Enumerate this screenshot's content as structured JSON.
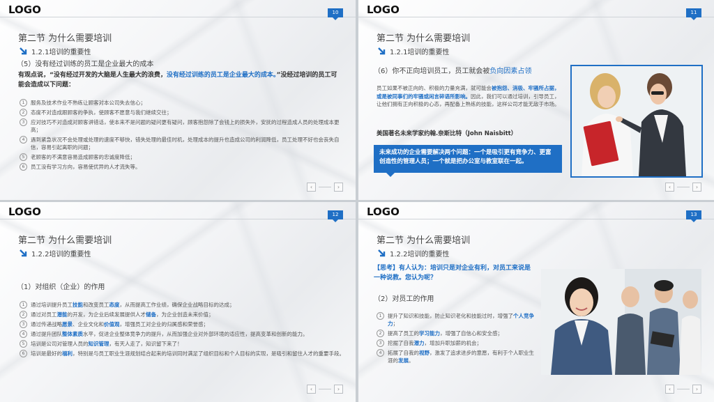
{
  "common": {
    "logo": "LOGO",
    "section_title": "第二节  为什么需要培训",
    "nav_prev": "‹",
    "nav_next": "›"
  },
  "slide1": {
    "page": "10",
    "subtitle": "1.2.1培训的重要性",
    "point": "（5）没有经过训练的员工是企业最大的成本",
    "intro_a": "有观点说，“没有经过开发的大脑是人生最大的浪费，",
    "intro_b": "没有经过训练的员工是企业最大的成本。",
    "intro_c": "”没经过培训的员工可能会造成以下问题：",
    "items": [
      "服务及技术作业不熟练让顾客对本公司失去信心；",
      "态度不对造成跟顾客的争执，使顾客不愿意与我们继续交往；",
      "应对技巧不对造成对顾客讲错话，使本来不是问题的疑问更有疑问，顾客抱怨除了会钱上的损失外，安抚的过程造成人员的处理成本更高；",
      "遇到紧急状况不会处理或处理的速度不够快，错失处理的最佳时机，处理成本的提升也造成公司的利润降低，员工处理不好也会丧失自信，容易引起离职的问题；",
      "老顾客的不满意容易造成顾客的忠诚度降低；",
      "员工没有学习方向，容易使优异的人才流失等。"
    ]
  },
  "slide2": {
    "page": "11",
    "subtitle": "1.2.1培训的重要性",
    "point_a": "（6）你不正向培训员工，员工就会被",
    "point_b": "负向因素占领",
    "body_a": "员工如果不被正向的、积极的力量充满，就可能会",
    "body_b": "被抱怨、消极、牢骚所占据，或是被同事们的牢骚或闲言碎语所影响。",
    "body_c": "因此，我们可以通过培训，引导员工，让他们拥有正向积极的心态，再配备上熟练的技能，这样公司才能无敌于市场。",
    "quote_author": "美国著名未来学家约翰.奈斯比特（John Naisbitt）",
    "quote": "未来成功的企业需要解决两个问题：一个是吸引更有竞争力、更富创造性的管理人员；一个就是把办公室与教室联在一起。"
  },
  "slide3": {
    "page": "12",
    "subtitle": "1.2.2培训的重要性",
    "point": "（1）对组织（企业）的作用",
    "items": [
      [
        "通过培训提升员工",
        "技能",
        "和改变员工",
        "态度",
        "，从而提高工作业绩，确保企业战略目标的达成；"
      ],
      [
        "通过对员工",
        "潜能",
        "的开发，为企业后续发展提供人才",
        "储备",
        "，为企业创造未来价值；"
      ],
      [
        "通过传递战略",
        "愿景",
        "、企业文化和",
        "价值观",
        "，增强员工对企业的归属感和荣誉感；"
      ],
      [
        "通过提升团队",
        "整体素质",
        "水平，促进企业整体竞争力的提升，从而加强企业对外部环境的适应性，提高变革和创新的能力。",
        "",
        ""
      ],
      [
        "培训是公司对管理人员的",
        "知识管理",
        "，有天人走了，知识留下来了！",
        "",
        ""
      ],
      [
        "培训是最好的",
        "福利",
        "，特别是与员工职业生涯规划结合起来的培训同时满足了组织目标和个人目标的实现，是吸引和留住人才的重要手段。",
        "",
        ""
      ]
    ]
  },
  "slide4": {
    "page": "13",
    "subtitle": "1.2.2培训的重要性",
    "think": "【思考】有人认为：培训只是对企业有利，对员工来说是一种说教。您认为呢？",
    "point": "（2）对员工的作用",
    "items": [
      [
        "提升了知识和技能，防止知识老化和技能过时，增强了",
        "个人竞争力",
        "；"
      ],
      [
        "提高了员工的",
        "学习能力",
        "，增强了自信心和安全感；"
      ],
      [
        "挖掘了自我",
        "潜力",
        "，增加升职加薪的机会；"
      ],
      [
        "拓展了自我的",
        "视野",
        "，激发了追求进步的意愿，有利于个人职业生涯的",
        "发展",
        "。"
      ]
    ]
  },
  "colors": {
    "accent": "#1f6fc5",
    "text": "#333333",
    "muted": "#555555"
  }
}
